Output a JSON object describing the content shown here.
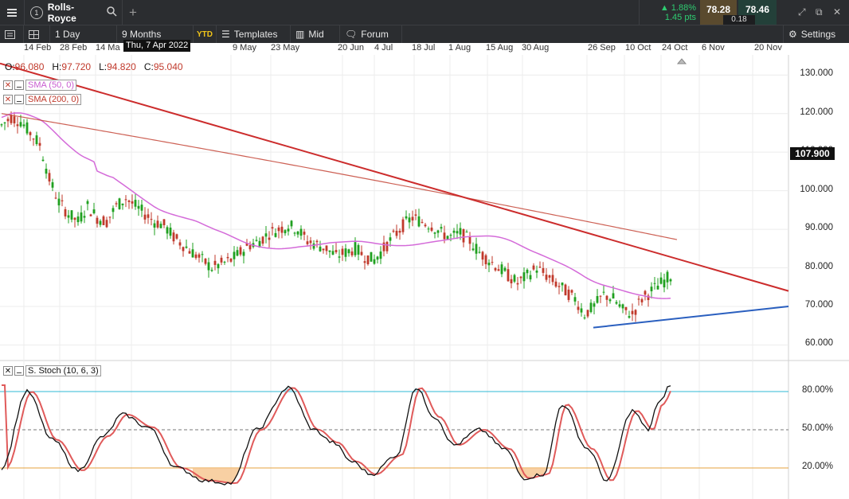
{
  "toolbar": {
    "tab_number": "1",
    "symbol": "Rolls-Royce",
    "change_pct": "▲ 1.88%",
    "change_pts": "1.45 pts",
    "bid": "78.28",
    "spread": "0.18",
    "ask": "78.46",
    "interval": "1 Day",
    "range": "9 Months",
    "ytd": "YTD",
    "templates": "Templates",
    "price_type": "Mid",
    "forum": "Forum",
    "settings": "Settings"
  },
  "crosshair": {
    "date": "Thu, 7 Apr 2022"
  },
  "ohlc": {
    "o_label": "O:",
    "o": "96.080",
    "h_label": "H:",
    "h": "97.720",
    "l_label": "L:",
    "l": "94.820",
    "c_label": "C:",
    "c": "95.040"
  },
  "legend": {
    "sma50": "SMA (50, 0)",
    "sma200": "SMA (200, 0)",
    "stoch": "S. Stoch (10, 6, 3)"
  },
  "last_price": "107.900",
  "colors": {
    "up": "#1fa01f",
    "down": "#c0392b",
    "sma50": "#d46bd9",
    "sma200": "#c0392b",
    "trend_down": "#cc2c2c",
    "trend_up": "#2a5fbf",
    "stoch_k": "#111111",
    "stoch_d": "#e05a5a",
    "level80": "#2fb8d6",
    "level20": "#e6a23c"
  },
  "chart_data": [
    {
      "type": "candlestick",
      "title": "Rolls-Royce",
      "x_ticks": [
        "14 Feb",
        "28 Feb",
        "14 Ma",
        "9 May",
        "23 May",
        "20 Jun",
        "4 Jul",
        "18 Jul",
        "1 Aug",
        "15 Aug",
        "30 Aug",
        "26 Sep",
        "10 Oct",
        "24 Oct",
        "6 Nov",
        "20 Nov"
      ],
      "y_ticks": [
        "130.000",
        "120.000",
        "110.000",
        "100.000",
        "90.000",
        "80.000",
        "70.000",
        "60.000"
      ],
      "ylim": [
        57,
        135
      ],
      "series": [
        {
          "name": "Price",
          "approx_close": [
            [
              0,
              117
            ],
            [
              3,
              119
            ],
            [
              6,
              118
            ],
            [
              9,
              115
            ],
            [
              12,
              112
            ],
            [
              15,
              103
            ],
            [
              18,
              97
            ],
            [
              21,
              94
            ],
            [
              24,
              92
            ],
            [
              27,
              96
            ],
            [
              30,
              93
            ],
            [
              33,
              92
            ],
            [
              36,
              96
            ],
            [
              39,
              98
            ],
            [
              42,
              96
            ],
            [
              45,
              94
            ],
            [
              48,
              92
            ],
            [
              51,
              91
            ],
            [
              54,
              88
            ],
            [
              57,
              86
            ],
            [
              60,
              84
            ],
            [
              63,
              82
            ],
            [
              66,
              80
            ],
            [
              69,
              81
            ],
            [
              72,
              82
            ],
            [
              75,
              84
            ],
            [
              78,
              86
            ],
            [
              81,
              87
            ],
            [
              84,
              89
            ],
            [
              87,
              90
            ],
            [
              90,
              91
            ],
            [
              93,
              90
            ],
            [
              96,
              87
            ],
            [
              99,
              86
            ],
            [
              102,
              85
            ],
            [
              105,
              83
            ],
            [
              108,
              84
            ],
            [
              111,
              85
            ],
            [
              114,
              83
            ],
            [
              117,
              82
            ],
            [
              120,
              85
            ],
            [
              123,
              88
            ],
            [
              126,
              91
            ],
            [
              129,
              93
            ],
            [
              132,
              92
            ],
            [
              135,
              91
            ],
            [
              138,
              89
            ],
            [
              141,
              88
            ],
            [
              144,
              89
            ],
            [
              147,
              87
            ],
            [
              150,
              84
            ],
            [
              153,
              82
            ],
            [
              156,
              80
            ],
            [
              159,
              78
            ],
            [
              162,
              76
            ],
            [
              165,
              78
            ],
            [
              168,
              80
            ],
            [
              171,
              78
            ],
            [
              174,
              76
            ],
            [
              177,
              74
            ],
            [
              180,
              72
            ],
            [
              183,
              68
            ],
            [
              186,
              70
            ],
            [
              189,
              73
            ],
            [
              192,
              72
            ],
            [
              195,
              69
            ],
            [
              198,
              68
            ],
            [
              201,
              72
            ],
            [
              204,
              74
            ],
            [
              207,
              76
            ],
            [
              210,
              78
            ]
          ]
        },
        {
          "name": "SMA (50, 0)"
        },
        {
          "name": "SMA (200, 0)"
        }
      ]
    },
    {
      "type": "line",
      "title": "S. Stoch (10, 6, 3)",
      "y_ticks": [
        "80.00%",
        "50.00%",
        "20.00%"
      ],
      "ylim": [
        0,
        100
      ],
      "levels": [
        80,
        50,
        20
      ]
    }
  ]
}
